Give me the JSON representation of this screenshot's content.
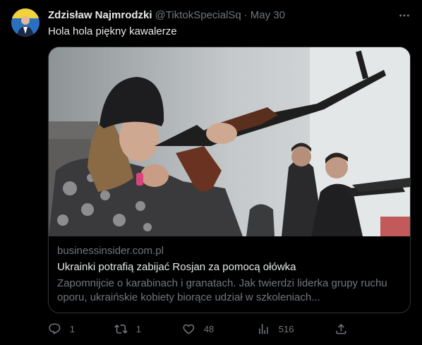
{
  "tweet": {
    "author_name": "Zdzisław Najmrodzki",
    "author_handle": "@TiktokSpecialSq",
    "separator": "·",
    "date": "May 30",
    "text": "Hola hola piękny kawalerze"
  },
  "card": {
    "domain": "businessinsider.com.pl",
    "title": "Ukrainki potrafią zabijać Rosjan za pomocą ołówka",
    "description": "Zapomnijcie o karabinach i granatach. Jak twierdzi liderka grupy ruchu oporu, ukraińskie kobiety biorące udział w szkoleniach..."
  },
  "actions": {
    "replies": "1",
    "retweets": "1",
    "likes": "48",
    "views": "516"
  },
  "icons": {
    "more": "more-icon",
    "reply": "reply-icon",
    "retweet": "retweet-icon",
    "like": "heart-icon",
    "views": "analytics-icon",
    "share": "share-icon"
  },
  "colors": {
    "background": "#000000",
    "text_primary": "#e7e9ea",
    "text_secondary": "#71767b",
    "border": "#2f3336"
  }
}
